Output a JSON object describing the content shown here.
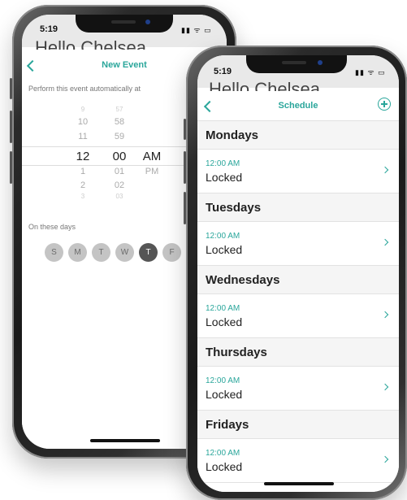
{
  "back_phone": {
    "status_time": "5:19",
    "greeting": "Hello Chelsea",
    "header": {
      "title": "New Event"
    },
    "prompt_label": "Perform this event automatically at",
    "picker": {
      "hours": [
        "9",
        "10",
        "11",
        "12",
        "1",
        "2",
        "3"
      ],
      "minutes": [
        "57",
        "58",
        "59",
        "00",
        "01",
        "02",
        "03"
      ],
      "periods": [
        "AM",
        "PM"
      ],
      "selected": {
        "hour": "12",
        "minute": "00",
        "period": "AM"
      }
    },
    "days_label": "On these days",
    "days": [
      {
        "label": "S",
        "selected": false
      },
      {
        "label": "M",
        "selected": false
      },
      {
        "label": "T",
        "selected": false
      },
      {
        "label": "W",
        "selected": false
      },
      {
        "label": "T",
        "selected": true
      },
      {
        "label": "F",
        "selected": false
      }
    ]
  },
  "front_phone": {
    "status_time": "5:19",
    "greeting": "Hello Chelsea",
    "header": {
      "title": "Schedule"
    },
    "groups": [
      {
        "day": "Mondays",
        "time": "12:00 AM",
        "state": "Locked"
      },
      {
        "day": "Tuesdays",
        "time": "12:00 AM",
        "state": "Locked"
      },
      {
        "day": "Wednesdays",
        "time": "12:00 AM",
        "state": "Locked"
      },
      {
        "day": "Thursdays",
        "time": "12:00 AM",
        "state": "Locked"
      },
      {
        "day": "Fridays",
        "time": "12:00 AM",
        "state": "Locked"
      }
    ]
  },
  "colors": {
    "accent": "#2aa69b",
    "selected_day": "#555555",
    "unselected_day": "#c4c4c4"
  }
}
